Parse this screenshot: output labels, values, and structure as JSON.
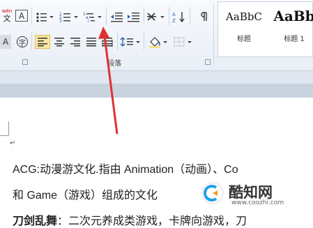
{
  "ribbon": {
    "row1": [
      "wen-icon",
      "char-border-icon",
      "bullets-icon",
      "numbering-icon",
      "multilevel-list-icon",
      "decrease-indent-icon",
      "increase-indent-icon",
      "chinese-layout-icon",
      "sort-icon",
      "show-marks-icon"
    ],
    "row2": [
      "char-shading-icon",
      "enclose-char-icon",
      "align-left-icon",
      "align-center-icon",
      "align-right-icon",
      "justify-icon",
      "distribute-icon",
      "line-spacing-icon",
      "shading-icon",
      "borders-icon"
    ],
    "wen_glyph": "wén",
    "char_border_glyph": "A",
    "char_shading_glyph": "A",
    "enclose_glyph": "字",
    "paragraph_group_label": "段落",
    "styles": [
      {
        "preview": "AaBbC",
        "name": "标题"
      },
      {
        "preview": "AaBb",
        "name": "标题 1"
      }
    ]
  },
  "document": {
    "lines": [
      "ACG:动漫游文化.指由 Animation（动画）、Co",
      "和 Game（游戏）组成的文化",
      "刀剑乱舞：二次元养成类游戏，卡牌向游戏，刀"
    ],
    "bold_prefix": "刀剑乱舞",
    "para_mark": "↵"
  },
  "watermark": {
    "brand": "酷知网",
    "url": "www.coozhi.com"
  },
  "colors": {
    "arrow": "#e03030",
    "pressed": "#fde9a2",
    "ribbon": "#f3f6fa"
  }
}
